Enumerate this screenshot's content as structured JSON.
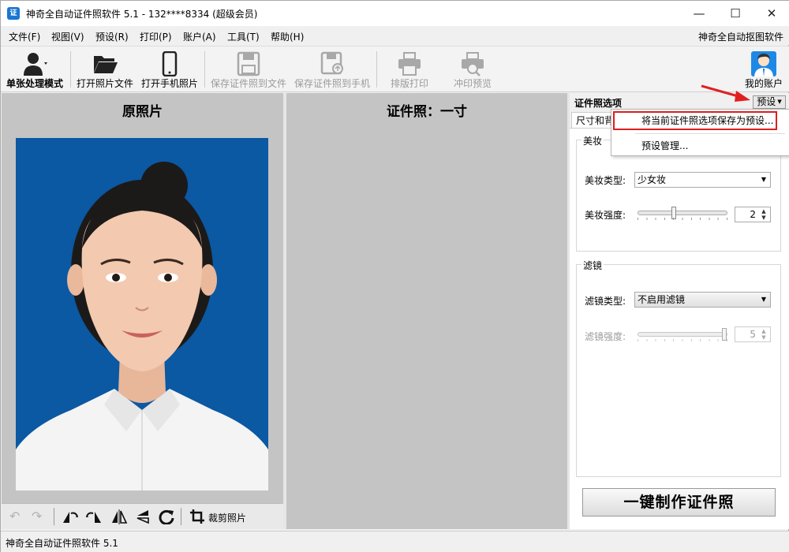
{
  "window": {
    "title": "神奇全自动证件照软件 5.1 - 132****8334 (超级会员)",
    "app_icon": "证",
    "minimize": "—",
    "maximize": "☐",
    "close": "✕"
  },
  "menu": {
    "items": [
      "文件(F)",
      "视图(V)",
      "预设(R)",
      "打印(P)",
      "账户(A)",
      "工具(T)",
      "帮助(H)"
    ],
    "right_link": "神奇全自动抠图软件"
  },
  "toolbar": {
    "single_mode": "单张处理模式",
    "open_file": "打开照片文件",
    "open_phone": "打开手机照片",
    "save_file": "保存证件照到文件",
    "save_phone": "保存证件照到手机",
    "layout_print": "排版打印",
    "print_preview": "冲印预览",
    "my_account": "我的账户"
  },
  "left_panel": {
    "title": "原照片",
    "crop_label": "裁剪照片"
  },
  "mid_panel": {
    "title": "证件照：一寸"
  },
  "right_panel": {
    "title": "证件照选项",
    "preset_button": "预设",
    "tab_label": "尺寸和背",
    "makeup": {
      "group_title": "美妆",
      "type_label": "美妆类型:",
      "type_value": "少女妆",
      "strength_label": "美妆强度:",
      "strength_value": "2"
    },
    "filter": {
      "group_title": "滤镜",
      "type_label": "滤镜类型:",
      "type_value": "不启用滤镜",
      "strength_label": "滤镜强度:",
      "strength_value": "5"
    },
    "make_button": "一键制作证件照"
  },
  "dropdown": {
    "save_preset": "将当前证件照选项保存为预设...",
    "manage_presets": "预设管理..."
  },
  "statusbar": {
    "text": "神奇全自动证件照软件 5.1"
  },
  "colors": {
    "photo_background": "#0b58a3",
    "highlight": "#d92020",
    "annotation_arrow": "#e02020"
  }
}
